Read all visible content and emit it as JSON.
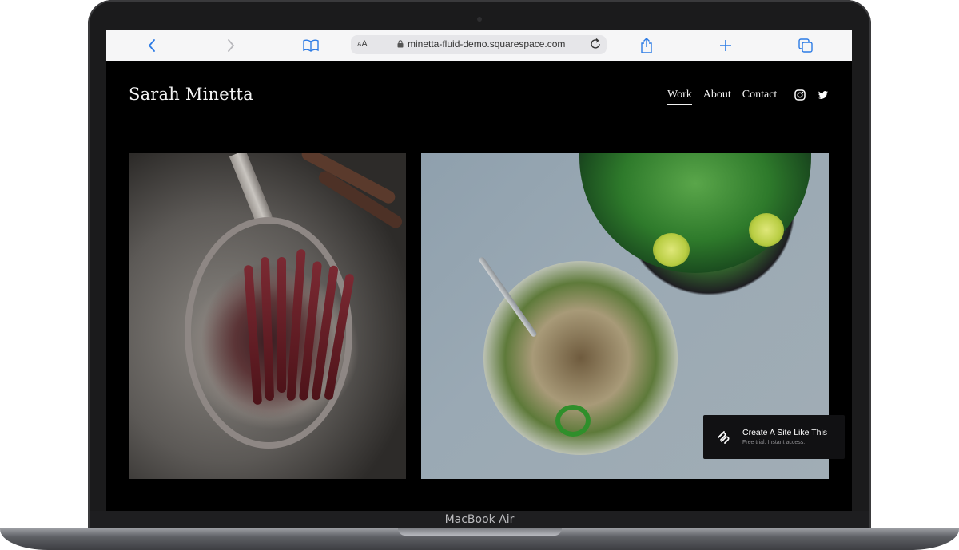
{
  "browser": {
    "url": "minetta-fluid-demo.squarespace.com",
    "aa": "AA"
  },
  "site": {
    "logo": "Sarah Minetta",
    "nav": [
      "Work",
      "About",
      "Contact"
    ],
    "social_icons": [
      "instagram-icon",
      "twitter-icon"
    ]
  },
  "promo": {
    "title": "Create A Site Like This",
    "subtitle": "Free trial. Instant access."
  },
  "device": {
    "model": "MacBook Air"
  },
  "colors": {
    "site_background": "#000000",
    "toolbar_accent": "#2c7be5"
  }
}
